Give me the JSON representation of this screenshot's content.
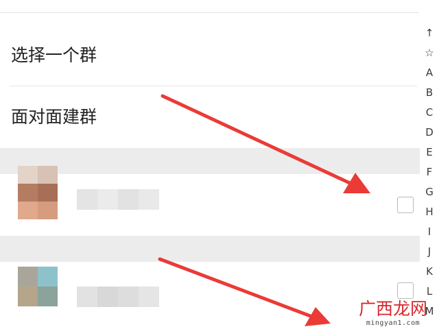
{
  "menu": {
    "select_group": "选择一个群",
    "face_to_face": "面对面建群"
  },
  "alphabet_index": [
    "↑",
    "☆",
    "A",
    "B",
    "C",
    "D",
    "E",
    "F",
    "G",
    "H",
    "I",
    "J",
    "K",
    "L",
    "M"
  ],
  "contacts": [
    {
      "avatar_colors": [
        "#cdb6aa",
        "#c9ab98",
        "#b98062",
        "#a97561"
      ],
      "avatar_colors_lower": [
        "#dca88c",
        "#d59e82"
      ],
      "checked": false
    },
    {
      "avatar_colors": [
        "#a9a49a",
        "#8cc0c9",
        "#b3a48b",
        "#8aa199"
      ],
      "checked": false
    }
  ],
  "colors": {
    "arrow": "#ea3b37",
    "watermark": "#d8262d"
  },
  "icons": {
    "checkbox": "checkbox-empty-icon",
    "arrow": "red-arrow-annotation"
  },
  "watermark": {
    "cn": "广西龙网",
    "en": "mingyan1.com"
  }
}
